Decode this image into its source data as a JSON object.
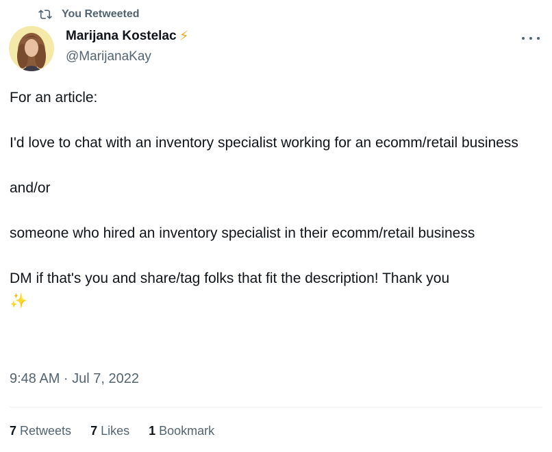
{
  "retweet_banner": {
    "text": "You Retweeted",
    "icon": "retweet-icon"
  },
  "author": {
    "display_name": "Marijana Kostelac",
    "badge_emoji": "⚡",
    "handle": "@MarijanaKay",
    "avatar": "avatar"
  },
  "more_menu": {
    "icon": "more-icon"
  },
  "tweet": {
    "paragraphs": [
      "For an article:",
      "I'd love to chat with an inventory specialist working for an ecomm/retail business",
      "and/or",
      "someone who hired an inventory specialist in their ecomm/retail business",
      "DM if that's you and share/tag folks that fit the description! Thank you"
    ],
    "trailing_emoji": "✨"
  },
  "timestamp": "9:48 AM · Jul 7, 2022",
  "stats": {
    "retweets": {
      "count": "7",
      "label": "Retweets"
    },
    "likes": {
      "count": "7",
      "label": "Likes"
    },
    "bookmarks": {
      "count": "1",
      "label": "Bookmark"
    }
  },
  "colors": {
    "text_primary": "#0f1419",
    "text_secondary": "#536471",
    "divider": "#eff3f4",
    "bolt": "#f5a623",
    "sparkle": "#f9c22e"
  }
}
